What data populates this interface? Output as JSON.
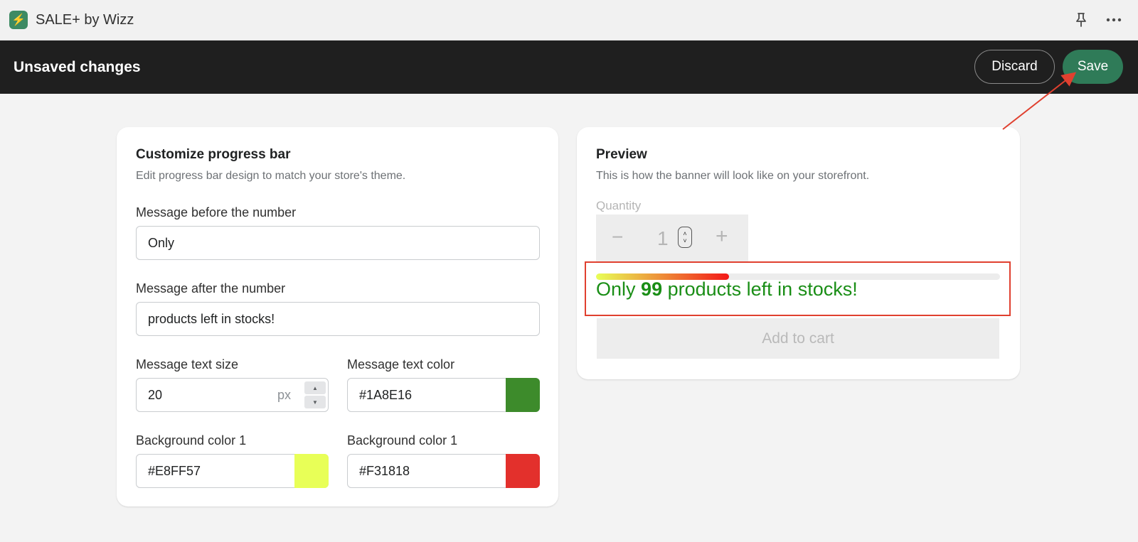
{
  "titlebar": {
    "app_title": "SALE+ by Wizz",
    "logo_icon": "sale-plus-logo",
    "pin_icon": "pin-icon",
    "more_icon": "more-horizontal-icon"
  },
  "savebar": {
    "title": "Unsaved changes",
    "discard_label": "Discard",
    "save_label": "Save"
  },
  "customize": {
    "title": "Customize progress bar",
    "subtitle": "Edit progress bar design to match your store's theme.",
    "before_label": "Message before the number",
    "before_value": "Only",
    "after_label": "Message after the number",
    "after_value": "products left in stocks!",
    "size_label": "Message text size",
    "size_value": "20",
    "size_unit": "px",
    "color_label": "Message text color",
    "color_value": "#1A8E16",
    "bg1_label": "Background color 1",
    "bg1_value": "#E8FF57",
    "bg2_label": "Background color 1",
    "bg2_value": "#F31818"
  },
  "preview": {
    "title": "Preview",
    "subtitle": "This is how the banner will look like on your storefront.",
    "quantity_label": "Quantity",
    "quantity_value": "1",
    "progress_fraction": 0.33,
    "message_before": "Only",
    "message_number": "99",
    "message_after": "products left in stocks!",
    "add_to_cart": "Add to cart"
  },
  "colors": {
    "accent_save": "#2f7b58",
    "text_color": "#1A8E16",
    "bg_color_1": "#E8FF57",
    "bg_color_2": "#F31818",
    "annotation": "#e0402f"
  }
}
